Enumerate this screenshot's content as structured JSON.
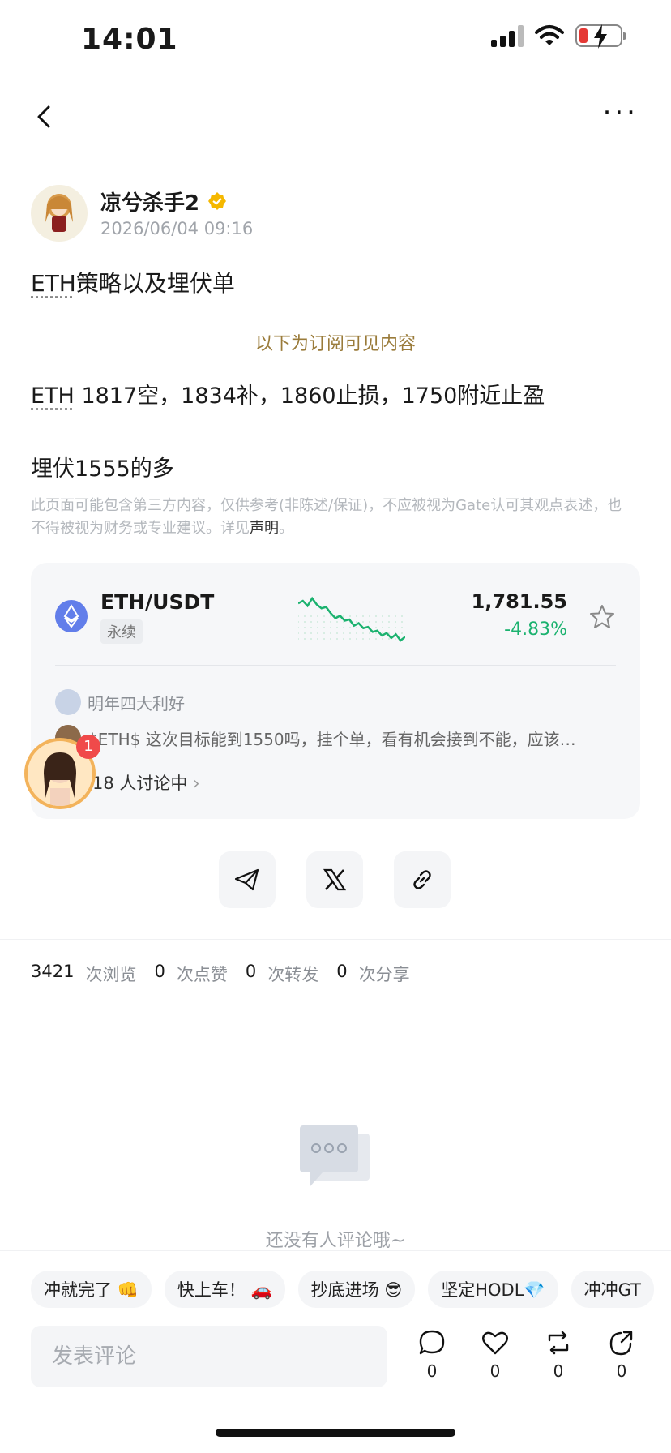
{
  "status": {
    "time": "14:01"
  },
  "author": {
    "name": "凉兮杀手2",
    "timestamp": "2026/06/04 09:16"
  },
  "post": {
    "title_prefix": "ETH",
    "title_rest": "策略以及埋伏单",
    "divider_label": "以下为订阅可见内容",
    "content_line1_prefix": "ETH",
    "content_line1_rest": " 1817空，1834补，1860止损，1750附近止盈",
    "content_line2": "埋伏1555的多",
    "disclaimer_text": "此页面可能包含第三方内容，仅供参考(非陈述/保证)，不应被视为Gate认可其观点表述，也不得被视为财务或专业建议。详见",
    "disclaimer_link": "声明",
    "disclaimer_end": "。"
  },
  "ticker": {
    "pair": "ETH/USDT",
    "tag": "永续",
    "price": "1,781.55",
    "change": "-4.83%",
    "change_color": "#1bb26f",
    "discussion_user": "明年四大利好",
    "discussion_text": "$ETH$  这次目标能到1550吗，挂个单，看有机会接到不能，应该…",
    "discussion_count": "18 人讨论中",
    "sparkline": [
      72,
      70,
      74,
      68,
      73,
      76,
      75,
      80,
      84,
      82,
      86,
      85,
      90,
      88,
      92,
      91,
      95,
      94,
      98,
      96,
      100,
      97,
      102,
      99
    ]
  },
  "float": {
    "badge": "1"
  },
  "stats": [
    {
      "num": "3421",
      "label": "次浏览"
    },
    {
      "num": "0",
      "label": "次点赞"
    },
    {
      "num": "0",
      "label": "次转发"
    },
    {
      "num": "0",
      "label": "次分享"
    }
  ],
  "comments": {
    "empty_text": "还没有人评论哦~"
  },
  "chips": [
    "冲就完了 👊",
    "快上车！ 🚗",
    "抄底进场 😎",
    "坚定HODL💎",
    "冲冲GT"
  ],
  "input": {
    "placeholder": "发表评论"
  },
  "actions": [
    {
      "icon": "comment-icon",
      "count": "0"
    },
    {
      "icon": "heart-icon",
      "count": "0"
    },
    {
      "icon": "repost-icon",
      "count": "0"
    },
    {
      "icon": "share-icon",
      "count": "0"
    }
  ],
  "colors": {
    "verified": "#f5b800",
    "gold_divider": "#9a7b3a",
    "eth_brand": "#627eea"
  }
}
